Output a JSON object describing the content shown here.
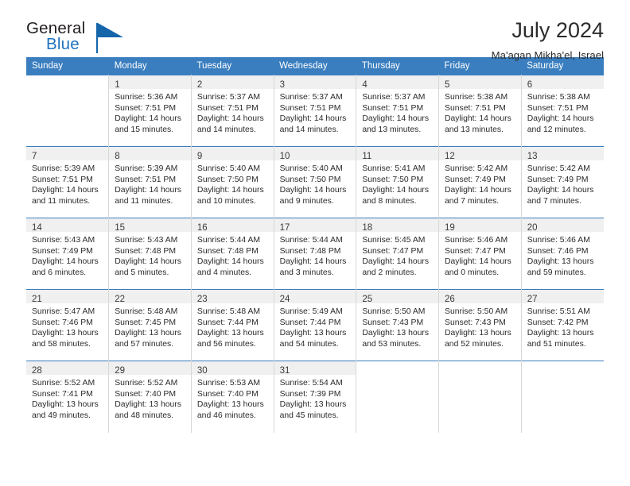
{
  "brand": {
    "name_part1": "General",
    "name_part2": "Blue",
    "accent_color": "#1565ab"
  },
  "header": {
    "title": "July 2024",
    "subtitle": "Ma'agan Mikha'el, Israel"
  },
  "theme": {
    "header_row_bg": "#3a7ebf",
    "daynum_band_bg": "#f0f0f0",
    "cell_border": "#d7d7d7"
  },
  "weekdays": [
    "Sunday",
    "Monday",
    "Tuesday",
    "Wednesday",
    "Thursday",
    "Friday",
    "Saturday"
  ],
  "weeks": [
    [
      {
        "day": "",
        "sunrise": "",
        "sunset": "",
        "daylight_line1": "",
        "daylight_line2": ""
      },
      {
        "day": "1",
        "sunrise": "Sunrise: 5:36 AM",
        "sunset": "Sunset: 7:51 PM",
        "daylight_line1": "Daylight: 14 hours",
        "daylight_line2": "and 15 minutes."
      },
      {
        "day": "2",
        "sunrise": "Sunrise: 5:37 AM",
        "sunset": "Sunset: 7:51 PM",
        "daylight_line1": "Daylight: 14 hours",
        "daylight_line2": "and 14 minutes."
      },
      {
        "day": "3",
        "sunrise": "Sunrise: 5:37 AM",
        "sunset": "Sunset: 7:51 PM",
        "daylight_line1": "Daylight: 14 hours",
        "daylight_line2": "and 14 minutes."
      },
      {
        "day": "4",
        "sunrise": "Sunrise: 5:37 AM",
        "sunset": "Sunset: 7:51 PM",
        "daylight_line1": "Daylight: 14 hours",
        "daylight_line2": "and 13 minutes."
      },
      {
        "day": "5",
        "sunrise": "Sunrise: 5:38 AM",
        "sunset": "Sunset: 7:51 PM",
        "daylight_line1": "Daylight: 14 hours",
        "daylight_line2": "and 13 minutes."
      },
      {
        "day": "6",
        "sunrise": "Sunrise: 5:38 AM",
        "sunset": "Sunset: 7:51 PM",
        "daylight_line1": "Daylight: 14 hours",
        "daylight_line2": "and 12 minutes."
      }
    ],
    [
      {
        "day": "7",
        "sunrise": "Sunrise: 5:39 AM",
        "sunset": "Sunset: 7:51 PM",
        "daylight_line1": "Daylight: 14 hours",
        "daylight_line2": "and 11 minutes."
      },
      {
        "day": "8",
        "sunrise": "Sunrise: 5:39 AM",
        "sunset": "Sunset: 7:51 PM",
        "daylight_line1": "Daylight: 14 hours",
        "daylight_line2": "and 11 minutes."
      },
      {
        "day": "9",
        "sunrise": "Sunrise: 5:40 AM",
        "sunset": "Sunset: 7:50 PM",
        "daylight_line1": "Daylight: 14 hours",
        "daylight_line2": "and 10 minutes."
      },
      {
        "day": "10",
        "sunrise": "Sunrise: 5:40 AM",
        "sunset": "Sunset: 7:50 PM",
        "daylight_line1": "Daylight: 14 hours",
        "daylight_line2": "and 9 minutes."
      },
      {
        "day": "11",
        "sunrise": "Sunrise: 5:41 AM",
        "sunset": "Sunset: 7:50 PM",
        "daylight_line1": "Daylight: 14 hours",
        "daylight_line2": "and 8 minutes."
      },
      {
        "day": "12",
        "sunrise": "Sunrise: 5:42 AM",
        "sunset": "Sunset: 7:49 PM",
        "daylight_line1": "Daylight: 14 hours",
        "daylight_line2": "and 7 minutes."
      },
      {
        "day": "13",
        "sunrise": "Sunrise: 5:42 AM",
        "sunset": "Sunset: 7:49 PM",
        "daylight_line1": "Daylight: 14 hours",
        "daylight_line2": "and 7 minutes."
      }
    ],
    [
      {
        "day": "14",
        "sunrise": "Sunrise: 5:43 AM",
        "sunset": "Sunset: 7:49 PM",
        "daylight_line1": "Daylight: 14 hours",
        "daylight_line2": "and 6 minutes."
      },
      {
        "day": "15",
        "sunrise": "Sunrise: 5:43 AM",
        "sunset": "Sunset: 7:48 PM",
        "daylight_line1": "Daylight: 14 hours",
        "daylight_line2": "and 5 minutes."
      },
      {
        "day": "16",
        "sunrise": "Sunrise: 5:44 AM",
        "sunset": "Sunset: 7:48 PM",
        "daylight_line1": "Daylight: 14 hours",
        "daylight_line2": "and 4 minutes."
      },
      {
        "day": "17",
        "sunrise": "Sunrise: 5:44 AM",
        "sunset": "Sunset: 7:48 PM",
        "daylight_line1": "Daylight: 14 hours",
        "daylight_line2": "and 3 minutes."
      },
      {
        "day": "18",
        "sunrise": "Sunrise: 5:45 AM",
        "sunset": "Sunset: 7:47 PM",
        "daylight_line1": "Daylight: 14 hours",
        "daylight_line2": "and 2 minutes."
      },
      {
        "day": "19",
        "sunrise": "Sunrise: 5:46 AM",
        "sunset": "Sunset: 7:47 PM",
        "daylight_line1": "Daylight: 14 hours",
        "daylight_line2": "and 0 minutes."
      },
      {
        "day": "20",
        "sunrise": "Sunrise: 5:46 AM",
        "sunset": "Sunset: 7:46 PM",
        "daylight_line1": "Daylight: 13 hours",
        "daylight_line2": "and 59 minutes."
      }
    ],
    [
      {
        "day": "21",
        "sunrise": "Sunrise: 5:47 AM",
        "sunset": "Sunset: 7:46 PM",
        "daylight_line1": "Daylight: 13 hours",
        "daylight_line2": "and 58 minutes."
      },
      {
        "day": "22",
        "sunrise": "Sunrise: 5:48 AM",
        "sunset": "Sunset: 7:45 PM",
        "daylight_line1": "Daylight: 13 hours",
        "daylight_line2": "and 57 minutes."
      },
      {
        "day": "23",
        "sunrise": "Sunrise: 5:48 AM",
        "sunset": "Sunset: 7:44 PM",
        "daylight_line1": "Daylight: 13 hours",
        "daylight_line2": "and 56 minutes."
      },
      {
        "day": "24",
        "sunrise": "Sunrise: 5:49 AM",
        "sunset": "Sunset: 7:44 PM",
        "daylight_line1": "Daylight: 13 hours",
        "daylight_line2": "and 54 minutes."
      },
      {
        "day": "25",
        "sunrise": "Sunrise: 5:50 AM",
        "sunset": "Sunset: 7:43 PM",
        "daylight_line1": "Daylight: 13 hours",
        "daylight_line2": "and 53 minutes."
      },
      {
        "day": "26",
        "sunrise": "Sunrise: 5:50 AM",
        "sunset": "Sunset: 7:43 PM",
        "daylight_line1": "Daylight: 13 hours",
        "daylight_line2": "and 52 minutes."
      },
      {
        "day": "27",
        "sunrise": "Sunrise: 5:51 AM",
        "sunset": "Sunset: 7:42 PM",
        "daylight_line1": "Daylight: 13 hours",
        "daylight_line2": "and 51 minutes."
      }
    ],
    [
      {
        "day": "28",
        "sunrise": "Sunrise: 5:52 AM",
        "sunset": "Sunset: 7:41 PM",
        "daylight_line1": "Daylight: 13 hours",
        "daylight_line2": "and 49 minutes."
      },
      {
        "day": "29",
        "sunrise": "Sunrise: 5:52 AM",
        "sunset": "Sunset: 7:40 PM",
        "daylight_line1": "Daylight: 13 hours",
        "daylight_line2": "and 48 minutes."
      },
      {
        "day": "30",
        "sunrise": "Sunrise: 5:53 AM",
        "sunset": "Sunset: 7:40 PM",
        "daylight_line1": "Daylight: 13 hours",
        "daylight_line2": "and 46 minutes."
      },
      {
        "day": "31",
        "sunrise": "Sunrise: 5:54 AM",
        "sunset": "Sunset: 7:39 PM",
        "daylight_line1": "Daylight: 13 hours",
        "daylight_line2": "and 45 minutes."
      },
      {
        "day": "",
        "sunrise": "",
        "sunset": "",
        "daylight_line1": "",
        "daylight_line2": ""
      },
      {
        "day": "",
        "sunrise": "",
        "sunset": "",
        "daylight_line1": "",
        "daylight_line2": ""
      },
      {
        "day": "",
        "sunrise": "",
        "sunset": "",
        "daylight_line1": "",
        "daylight_line2": ""
      }
    ]
  ]
}
